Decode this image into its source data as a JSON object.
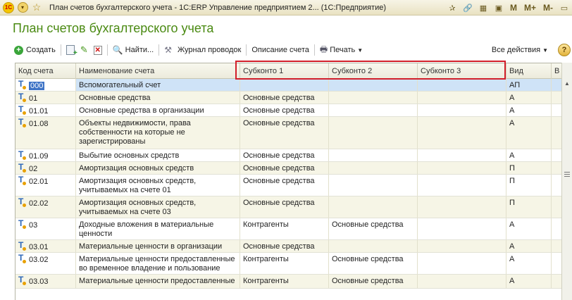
{
  "window": {
    "title": "План счетов бухгалтерского учета - 1С:ERP Управление предприятием 2... (1С:Предприятие)",
    "memory_buttons": [
      "M",
      "M+",
      "M-"
    ]
  },
  "page": {
    "title": "План счетов бухгалтерского учета"
  },
  "toolbar": {
    "create": "Создать",
    "find": "Найти...",
    "journal": "Журнал проводок",
    "description": "Описание счета",
    "print": "Печать",
    "all_actions": "Все действия",
    "help": "?"
  },
  "grid": {
    "columns": {
      "code": "Код счета",
      "name": "Наименование счета",
      "sub1": "Субконто 1",
      "sub2": "Субконто 2",
      "sub3": "Субконто 3",
      "kind": "Вид",
      "extra": "В"
    },
    "rows": [
      {
        "code": "000",
        "name": "Вспомогательный счет",
        "sub1": "",
        "sub2": "",
        "sub3": "",
        "kind": "АП"
      },
      {
        "code": "01",
        "name": "Основные средства",
        "sub1": "Основные средства",
        "sub2": "",
        "sub3": "",
        "kind": "А"
      },
      {
        "code": "01.01",
        "name": "Основные средства в организации",
        "sub1": "Основные средства",
        "sub2": "",
        "sub3": "",
        "kind": "А"
      },
      {
        "code": "01.08",
        "name": "Объекты недвижимости, права собственности на которые не зарегистрированы",
        "sub1": "Основные средства",
        "sub2": "",
        "sub3": "",
        "kind": "А"
      },
      {
        "code": "01.09",
        "name": "Выбытие основных средств",
        "sub1": "Основные средства",
        "sub2": "",
        "sub3": "",
        "kind": "А"
      },
      {
        "code": "02",
        "name": "Амортизация основных средств",
        "sub1": "Основные средства",
        "sub2": "",
        "sub3": "",
        "kind": "П"
      },
      {
        "code": "02.01",
        "name": "Амортизация основных средств, учитываемых на счете 01",
        "sub1": "Основные средства",
        "sub2": "",
        "sub3": "",
        "kind": "П"
      },
      {
        "code": "02.02",
        "name": "Амортизация основных средств, учитываемых на счете 03",
        "sub1": "Основные средства",
        "sub2": "",
        "sub3": "",
        "kind": "П"
      },
      {
        "code": "03",
        "name": "Доходные вложения в материальные ценности",
        "sub1": "Контрагенты",
        "sub2": "Основные средства",
        "sub3": "",
        "kind": "А"
      },
      {
        "code": "03.01",
        "name": "Материальные ценности в организации",
        "sub1": "Основные средства",
        "sub2": "",
        "sub3": "",
        "kind": "А"
      },
      {
        "code": "03.02",
        "name": "Материальные ценности предоставленные во временное владение и пользование",
        "sub1": "Контрагенты",
        "sub2": "Основные средства",
        "sub3": "",
        "kind": "А"
      },
      {
        "code": "03.03",
        "name": "Материальные ценности предоставленные",
        "sub1": "Контрагенты",
        "sub2": "Основные средства",
        "sub3": "",
        "kind": "А"
      }
    ]
  },
  "icons": {
    "app": "1c-logo-icon",
    "account": "account-t-icon"
  },
  "colors": {
    "title": "#4a8a12",
    "selection": "#cfe3f7",
    "highlight_frame": "#d21f2a",
    "alt_row": "#f6f5e6"
  }
}
